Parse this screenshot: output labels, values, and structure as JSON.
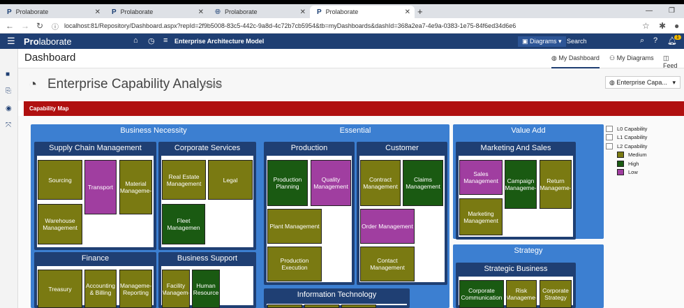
{
  "browser": {
    "tabs": [
      {
        "title": "Prolaborate",
        "icon": "P"
      },
      {
        "title": "Prolaborate",
        "icon": "P"
      },
      {
        "title": "Prolaborate",
        "icon": "globe"
      },
      {
        "title": "Prolaborate",
        "icon": "P"
      }
    ],
    "url": "localhost:81/Repository/Dashboard.aspx?repId=2f9b5008-83c5-442c-9a8d-4c72b7cb5954&tb=myDashboards&dashId=368a2ea7-4e9a-0383-1e75-84f6ed34d6e6"
  },
  "app": {
    "logo_bold": "Pro",
    "logo_rest": "laborate",
    "model_name": "Enterprise Architecture Model",
    "diagrams_label": "Diagrams",
    "search_placeholder": "Search",
    "notification_count": "1"
  },
  "subheader": {
    "title": "Dashboard",
    "nav": [
      "My Dashboard",
      "My Diagrams",
      "Feed"
    ]
  },
  "page": {
    "title": "Enterprise Capability Analysis",
    "tag": "[Default]",
    "dropdown": "Enterprise Capa..."
  },
  "capmap": {
    "bar_label": "Capability Map",
    "l0": [
      "Business Necessity",
      "Essential",
      "Value Add",
      "Strategy"
    ],
    "l1": [
      "Supply Chain Management",
      "Corporate Services",
      "Finance",
      "Business Support",
      "Production",
      "Customer",
      "Information Technology",
      "Marketing And Sales",
      "Strategic Business"
    ],
    "l2": {
      "sourcing": "Sourcing",
      "transport": "Transport",
      "material": "Material Manageme-",
      "warehouse": "Warehouse Management",
      "realestate": "Real Estate Management",
      "legal": "Legal",
      "fleet": "Fleet Managemen",
      "treasury": "Treasury",
      "accounting": "Accounting & Billing",
      "mgmtreporting": "Manageme- Reporting",
      "facility": "Facility Managem-",
      "hr": "Human Resource",
      "prodplanning": "Production Planning",
      "quality": "Quality Management",
      "plant": "Plant Management",
      "prodexec": "Production Execution",
      "contract": "Contract Management",
      "claims": "Claims Management",
      "order": "Order Management",
      "contact": "Contact Management",
      "sales": "Sales Management",
      "campaign": "Campaign Manageme-",
      "return": "Return Manageme-",
      "marketing": "Marketing Management",
      "corpcomm": "Corporate Communication",
      "risk": "Risk Manageme-",
      "corpstrategy": "Corporate Strategy"
    }
  },
  "legend": {
    "items": [
      "L0 Capability",
      "L1 Capability",
      "L2 Capability"
    ],
    "levels": [
      "Medium",
      "High",
      "Low"
    ],
    "colors": {
      "medium": "#7a7a12",
      "high": "#1a5a12",
      "low": "#a03ea0",
      "l0": "#3c7fd1",
      "l1": "#1f3f73",
      "bar": "#b01010"
    }
  }
}
